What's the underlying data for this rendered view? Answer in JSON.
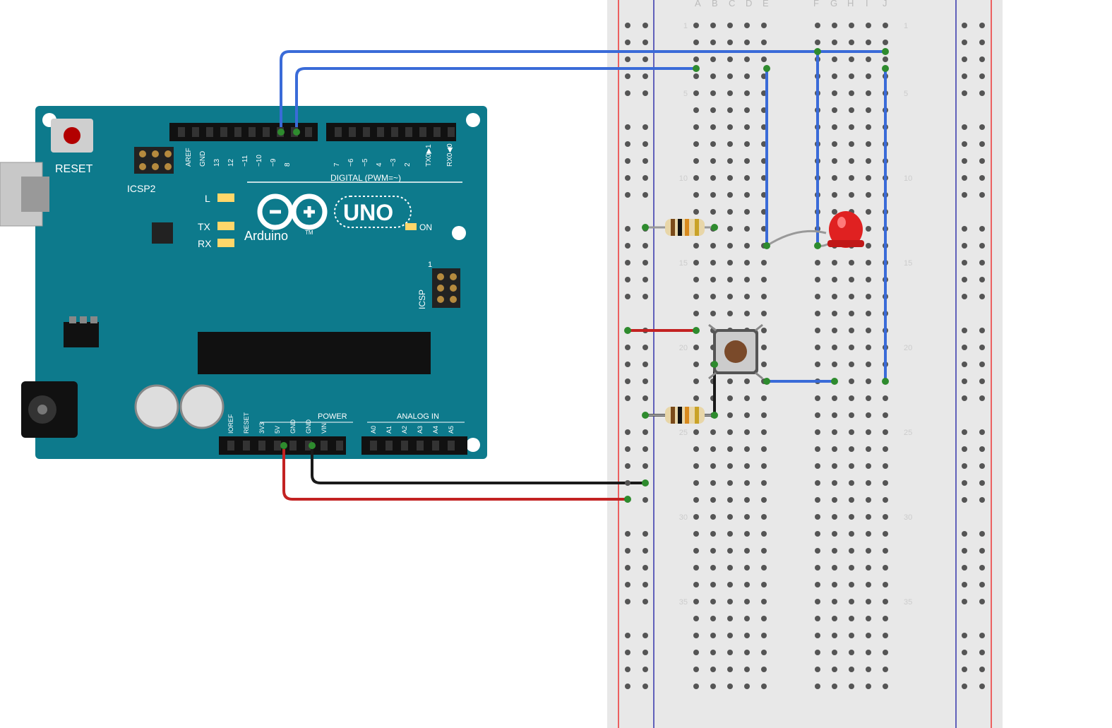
{
  "board": {
    "name": "Arduino",
    "model": "UNO",
    "reset_label": "RESET",
    "icsp2_label": "ICSP2",
    "icsp_label": "ICSP",
    "icsp_pins": [
      "1"
    ],
    "on_label": "ON",
    "l_label": "L",
    "tx_label": "TX",
    "rx_label": "RX",
    "pwm_label": "DIGITAL (PWM=~)",
    "power_label": "POWER",
    "analog_label": "ANALOG IN",
    "tm": "TM",
    "digital_pins": [
      "AREF",
      "GND",
      "13",
      "12",
      "~11",
      "~10",
      "~9",
      "8",
      "7",
      "~6",
      "~5",
      "4",
      "~3",
      "2",
      "TX0▶1",
      "RX0◀0"
    ],
    "power_pins": [
      "IOREF",
      "RESET",
      "3V3",
      "5V",
      "GND",
      "GND",
      "VIN"
    ],
    "analog_pins": [
      "A0",
      "A1",
      "A2",
      "A3",
      "A4",
      "A5"
    ]
  },
  "breadboard": {
    "cols": [
      "A",
      "B",
      "C",
      "D",
      "E",
      "F",
      "G",
      "H",
      "I",
      "J"
    ],
    "rows": [
      1,
      5,
      10,
      15,
      20,
      25,
      30,
      35
    ]
  },
  "components": {
    "led": {
      "color": "#e02121",
      "type": "LED"
    },
    "button": {
      "type": "tactile-pushbutton"
    },
    "resistor1": {
      "type": "resistor",
      "bands": [
        "brown",
        "black",
        "orange",
        "gold"
      ]
    },
    "resistor2": {
      "type": "resistor",
      "bands": [
        "brown",
        "black",
        "orange",
        "gold"
      ]
    }
  },
  "wires": [
    {
      "from": "Arduino D9",
      "to": "breadboard row2",
      "color": "blue"
    },
    {
      "from": "Arduino D8",
      "to": "breadboard row4",
      "color": "blue"
    },
    {
      "from": "Arduino GND(power)",
      "to": "breadboard blue rail",
      "color": "black"
    },
    {
      "from": "Arduino 5V",
      "to": "breadboard red rail",
      "color": "red"
    },
    {
      "from": "red rail",
      "to": "row19 A",
      "color": "red"
    },
    {
      "from": "E2",
      "to": "E14",
      "color": "blue"
    },
    {
      "from": "F4",
      "to": "F22",
      "color": "blue"
    },
    {
      "from": "I2",
      "to": "I22",
      "color": "blue"
    },
    {
      "from": "F22",
      "to": "G22",
      "color": "blue"
    },
    {
      "from": "E23",
      "to": "blue-rail",
      "color": "black"
    }
  ],
  "colors": {
    "wire_blue": "#3a6bd8",
    "wire_red": "#c32222",
    "wire_black": "#1a1a1a",
    "board": "#0d7a8c"
  }
}
